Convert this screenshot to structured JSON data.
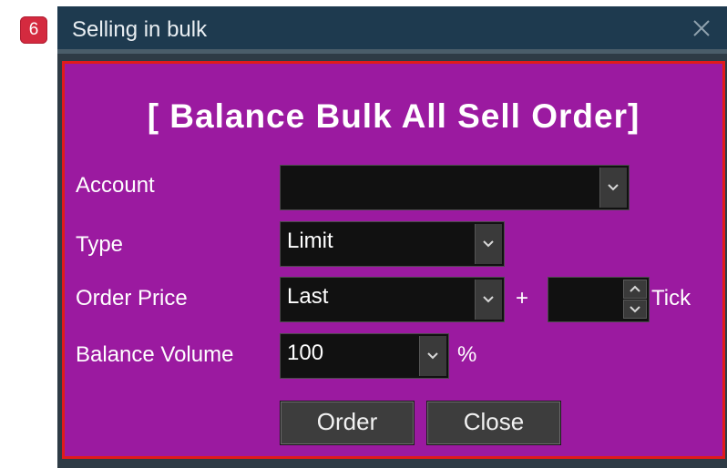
{
  "step_badge": "6",
  "window": {
    "title": "Selling in bulk"
  },
  "panel": {
    "heading": "[ Balance Bulk All Sell Order]",
    "account": {
      "label": "Account",
      "value": ""
    },
    "type": {
      "label": "Type",
      "value": "Limit"
    },
    "order_price": {
      "label": "Order Price",
      "value": "Last",
      "plus": "+",
      "tick_value": "",
      "tick_label": "Tick"
    },
    "balance_volume": {
      "label": "Balance Volume",
      "value": "100",
      "unit": "%"
    },
    "buttons": {
      "order": "Order",
      "close": "Close"
    }
  },
  "colors": {
    "panel_bg": "#9b1aa0",
    "panel_border": "#e01b1b",
    "titlebar": "#1e3a4f",
    "badge": "#d42a3f"
  }
}
